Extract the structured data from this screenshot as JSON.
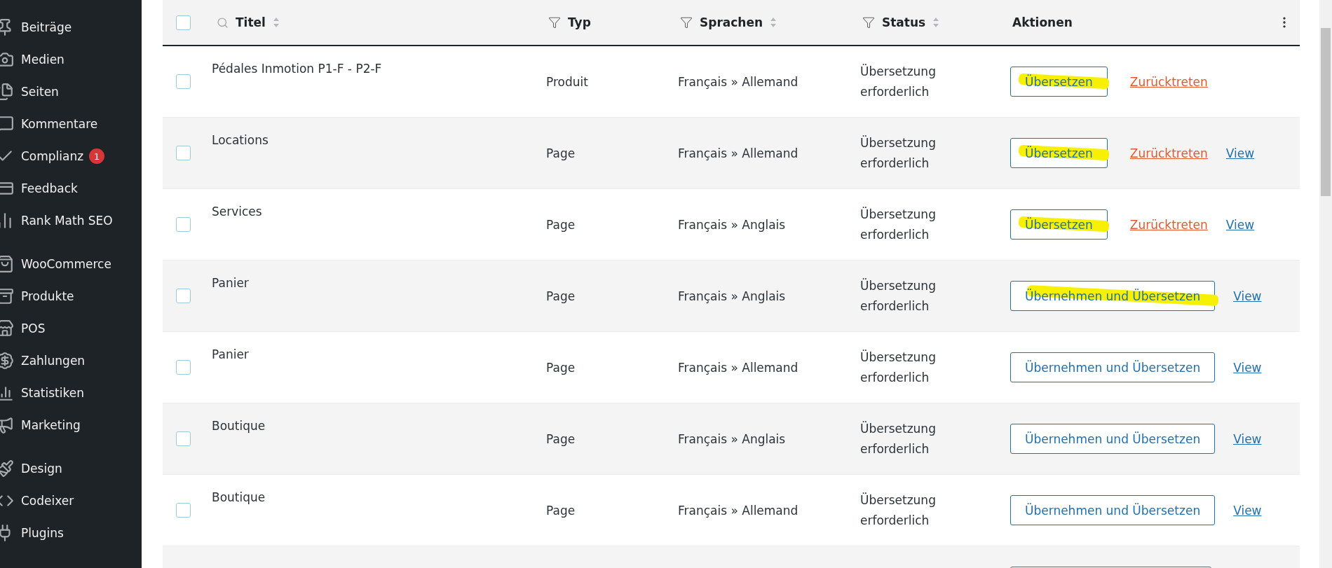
{
  "sidebar": {
    "groups": [
      {
        "items": [
          {
            "label": "Beiträge"
          },
          {
            "label": "Medien"
          },
          {
            "label": "Seiten"
          },
          {
            "label": "Kommentare"
          },
          {
            "label": "Complianz",
            "badge": "1"
          },
          {
            "label": "Feedback"
          },
          {
            "label": "Rank Math SEO"
          }
        ]
      },
      {
        "items": [
          {
            "label": "WooCommerce"
          },
          {
            "label": "Produkte"
          },
          {
            "label": "POS"
          },
          {
            "label": "Zahlungen"
          },
          {
            "label": "Statistiken"
          },
          {
            "label": "Marketing"
          }
        ]
      },
      {
        "items": [
          {
            "label": "Design"
          },
          {
            "label": "Codeixer"
          },
          {
            "label": "Plugins"
          }
        ]
      }
    ]
  },
  "table": {
    "select_all": {
      "checked": false
    },
    "columns": [
      {
        "label": "Titel",
        "kind": "search",
        "sortable": true
      },
      {
        "label": "Typ",
        "kind": "filter",
        "sortable": false
      },
      {
        "label": "Sprachen",
        "kind": "filter",
        "sortable": true
      },
      {
        "label": "Status",
        "kind": "filter",
        "sortable": true
      },
      {
        "label": "Aktionen",
        "kind": "plain",
        "sortable": false
      }
    ],
    "rows": [
      {
        "checked": false,
        "title": "Pédales Inmotion P1-F - P2-F",
        "type": "Produit",
        "languages": "Français » Allemand",
        "status": "Übersetzung erforderlich",
        "actions": [
          {
            "kind": "button",
            "label": "Übersetzen",
            "highlighted": true
          },
          {
            "kind": "danger-link",
            "label": "Zurücktreten"
          }
        ]
      },
      {
        "checked": false,
        "title": "Locations",
        "type": "Page",
        "languages": "Français » Allemand",
        "status": "Übersetzung erforderlich",
        "actions": [
          {
            "kind": "button",
            "label": "Übersetzen",
            "highlighted": true
          },
          {
            "kind": "danger-link",
            "label": "Zurücktreten"
          },
          {
            "kind": "link",
            "label": "View"
          }
        ]
      },
      {
        "checked": false,
        "title": "Services",
        "type": "Page",
        "languages": "Français » Anglais",
        "status": "Übersetzung erforderlich",
        "actions": [
          {
            "kind": "button",
            "label": "Übersetzen",
            "highlighted": true
          },
          {
            "kind": "danger-link",
            "label": "Zurücktreten"
          },
          {
            "kind": "link",
            "label": "View"
          }
        ]
      },
      {
        "checked": false,
        "title": "Panier",
        "type": "Page",
        "languages": "Français » Anglais",
        "status": "Übersetzung erforderlich",
        "actions": [
          {
            "kind": "button",
            "label": "Übernehmen und Übersetzen",
            "highlighted": true
          },
          {
            "kind": "link",
            "label": "View"
          }
        ]
      },
      {
        "checked": false,
        "title": "Panier",
        "type": "Page",
        "languages": "Français » Allemand",
        "status": "Übersetzung erforderlich",
        "actions": [
          {
            "kind": "button",
            "label": "Übernehmen und Übersetzen",
            "highlighted": false
          },
          {
            "kind": "link",
            "label": "View"
          }
        ]
      },
      {
        "checked": false,
        "title": "Boutique",
        "type": "Page",
        "languages": "Français » Anglais",
        "status": "Übersetzung erforderlich",
        "actions": [
          {
            "kind": "button",
            "label": "Übernehmen und Übersetzen",
            "highlighted": false
          },
          {
            "kind": "link",
            "label": "View"
          }
        ]
      },
      {
        "checked": false,
        "title": "Boutique",
        "type": "Page",
        "languages": "Français » Allemand",
        "status": "Übersetzung erforderlich",
        "actions": [
          {
            "kind": "button",
            "label": "Übernehmen und Übersetzen",
            "highlighted": false
          },
          {
            "kind": "link",
            "label": "View"
          }
        ]
      },
      {
        "actions": [
          {
            "kind": "button",
            "highlighted": false
          }
        ]
      }
    ]
  }
}
